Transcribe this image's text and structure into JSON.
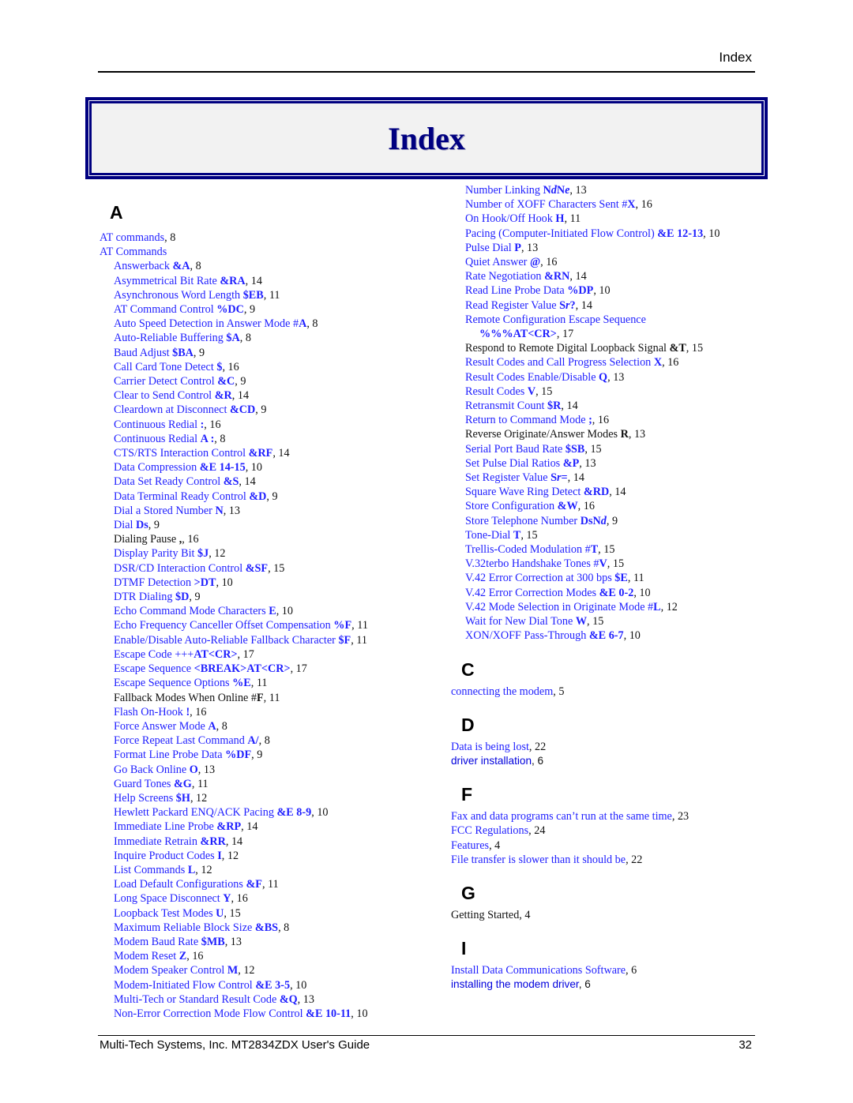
{
  "header": {
    "running_title": "Index"
  },
  "title": "Index",
  "footer": {
    "left": "Multi-Tech Systems, Inc. MT2834ZDX User's Guide",
    "page_number": "32"
  },
  "colors": {
    "link": "#1f1fff",
    "title": "#000080",
    "text": "#111111"
  },
  "left_column": {
    "sections": [
      {
        "letter": "A",
        "entries": [
          {
            "text": "AT commands",
            "code": "",
            "page": "8",
            "level": 0,
            "link": true
          },
          {
            "text": "AT Commands",
            "code": "",
            "page": "",
            "level": 0,
            "link": true
          },
          {
            "text": "Answerback ",
            "code": "&A",
            "page": "8",
            "level": 1,
            "link": true
          },
          {
            "text": "Asymmetrical Bit Rate ",
            "code": "&RA",
            "page": "14",
            "level": 1,
            "link": true
          },
          {
            "text": "Asynchronous Word Length ",
            "code": "$EB",
            "page": "11",
            "level": 1,
            "link": true
          },
          {
            "text": "AT Command Control ",
            "code": "%DC",
            "page": "9",
            "level": 1,
            "link": true
          },
          {
            "text": "Auto Speed Detection in Answer Mode #",
            "code": "A",
            "page": "8",
            "level": 1,
            "link": true
          },
          {
            "text": "Auto-Reliable Buffering ",
            "code": "$A",
            "page": "8",
            "level": 1,
            "link": true
          },
          {
            "text": "Baud Adjust ",
            "code": "$BA",
            "page": "9",
            "level": 1,
            "link": true
          },
          {
            "text": "Call Card Tone Detect ",
            "code": "$",
            "page": "16",
            "level": 1,
            "link": true
          },
          {
            "text": "Carrier Detect Control ",
            "code": "&C",
            "page": "9",
            "level": 1,
            "link": true
          },
          {
            "text": "Clear to Send Control ",
            "code": "&R",
            "page": "14",
            "level": 1,
            "link": true
          },
          {
            "text": "Cleardown at Disconnect ",
            "code": "&CD",
            "page": "9",
            "level": 1,
            "link": true
          },
          {
            "text": "Continuous Redial ",
            "code": ":",
            "page": "16",
            "level": 1,
            "link": true
          },
          {
            "text": "Continuous Redial ",
            "code": "A :",
            "page": "8",
            "level": 1,
            "link": true
          },
          {
            "text": "CTS/RTS Interaction Control ",
            "code": "&RF",
            "page": "14",
            "level": 1,
            "link": true
          },
          {
            "text": "Data Compression ",
            "code": "&E 14-15",
            "page": "10",
            "level": 1,
            "link": true
          },
          {
            "text": "Data Set Ready Control ",
            "code": "&S",
            "page": "14",
            "level": 1,
            "link": true
          },
          {
            "text": "Data Terminal Ready Control ",
            "code": "&D",
            "page": "9",
            "level": 1,
            "link": true
          },
          {
            "text": "Dial a Stored Number ",
            "code": "N",
            "page": "13",
            "level": 1,
            "link": true
          },
          {
            "text": "Dial ",
            "code": "Ds",
            "page": "9",
            "level": 1,
            "link": true
          },
          {
            "text": "Dialing Pause ",
            "code": ",",
            "page": "16",
            "level": 1,
            "link": false
          },
          {
            "text": "Display Parity Bit ",
            "code": "$J",
            "page": "12",
            "level": 1,
            "link": true
          },
          {
            "text": "DSR/CD Interaction Control ",
            "code": "&SF",
            "page": "15",
            "level": 1,
            "link": true
          },
          {
            "text": "DTMF Detection ",
            "code": ">DT",
            "page": "10",
            "level": 1,
            "link": true
          },
          {
            "text": "DTR Dialing ",
            "code": "$D",
            "page": "9",
            "level": 1,
            "link": true
          },
          {
            "text": "Echo Command Mode Characters ",
            "code": "E",
            "page": "10",
            "level": 1,
            "link": true
          },
          {
            "text": "Echo Frequency Canceller Offset Compensation ",
            "code": "%F",
            "page": "11",
            "level": 1,
            "link": true
          },
          {
            "text": "Enable/Disable Auto-Reliable Fallback Character ",
            "code": "$F",
            "page": "11",
            "level": 1,
            "link": true
          },
          {
            "text": "Escape Code +++",
            "code": "AT<CR>",
            "page": "17",
            "level": 1,
            "link": true
          },
          {
            "text": "Escape Sequence ",
            "code": "<BREAK>AT<CR>",
            "page": "17",
            "level": 1,
            "link": true
          },
          {
            "text": "Escape Sequence Options ",
            "code": "%E",
            "page": "11",
            "level": 1,
            "link": true
          },
          {
            "text": "Fallback Modes When Online #",
            "code": "F",
            "page": "11",
            "level": 1,
            "link": false
          },
          {
            "text": "Flash On-Hook ",
            "code": "!",
            "page": "16",
            "level": 1,
            "link": true
          },
          {
            "text": "Force Answer Mode ",
            "code": "A",
            "page": "8",
            "level": 1,
            "link": true
          },
          {
            "text": "Force Repeat Last Command ",
            "code": "A/",
            "page": "8",
            "level": 1,
            "link": true
          },
          {
            "text": "Format Line Probe Data ",
            "code": "%DF",
            "page": "9",
            "level": 1,
            "link": true
          },
          {
            "text": "Go Back Online ",
            "code": "O",
            "page": "13",
            "level": 1,
            "link": true
          },
          {
            "text": "Guard Tones ",
            "code": "&G",
            "page": "11",
            "level": 1,
            "link": true
          },
          {
            "text": "Help Screens ",
            "code": "$H",
            "page": "12",
            "level": 1,
            "link": true
          },
          {
            "text": "Hewlett Packard ENQ/ACK Pacing ",
            "code": "&E 8-9",
            "page": "10",
            "level": 1,
            "link": true
          },
          {
            "text": "Immediate Line Probe ",
            "code": "&RP",
            "page": "14",
            "level": 1,
            "link": true
          },
          {
            "text": "Immediate Retrain ",
            "code": "&RR",
            "page": "14",
            "level": 1,
            "link": true
          },
          {
            "text": "Inquire Product Codes ",
            "code": "I",
            "page": "12",
            "level": 1,
            "link": true
          },
          {
            "text": "List Commands ",
            "code": "L",
            "page": "12",
            "level": 1,
            "link": true
          },
          {
            "text": "Load Default Configurations ",
            "code": "&F",
            "page": "11",
            "level": 1,
            "link": true
          },
          {
            "text": "Long Space Disconnect ",
            "code": "Y",
            "page": "16",
            "level": 1,
            "link": true
          },
          {
            "text": "Loopback Test Modes ",
            "code": "U",
            "page": "15",
            "level": 1,
            "link": true
          },
          {
            "text": "Maximum Reliable Block Size ",
            "code": "&BS",
            "page": "8",
            "level": 1,
            "link": true
          },
          {
            "text": "Modem Baud Rate ",
            "code": "$MB",
            "page": "13",
            "level": 1,
            "link": true
          },
          {
            "text": "Modem Reset ",
            "code": "Z",
            "page": "16",
            "level": 1,
            "link": true
          },
          {
            "text": "Modem Speaker Control ",
            "code": "M",
            "page": "12",
            "level": 1,
            "link": true
          },
          {
            "text": "Modem-Initiated Flow Control ",
            "code": "&E 3-5",
            "page": "10",
            "level": 1,
            "link": true
          },
          {
            "text": "Multi-Tech or Standard Result Code ",
            "code": "&Q",
            "page": "13",
            "level": 1,
            "link": true
          },
          {
            "text": "Non-Error Correction Mode Flow Control ",
            "code": "&E 10-11",
            "page": "10",
            "level": 1,
            "link": true
          }
        ]
      }
    ]
  },
  "right_column": {
    "continued_entries": [
      {
        "text": "Number Linking ",
        "code": "NdNe",
        "page": "13",
        "level": 1,
        "link": true
      },
      {
        "text": "Number of XOFF Characters Sent #",
        "code": "X",
        "page": "16",
        "level": 1,
        "link": true
      },
      {
        "text": "On Hook/Off Hook ",
        "code": "H",
        "page": "11",
        "level": 1,
        "link": true
      },
      {
        "text": "Pacing (Computer-Initiated Flow Control) ",
        "code": "&E 12-13",
        "page": "10",
        "level": 1,
        "link": true
      },
      {
        "text": "Pulse Dial ",
        "code": "P",
        "page": "13",
        "level": 1,
        "link": true
      },
      {
        "text": "Quiet Answer ",
        "code": "@",
        "page": "16",
        "level": 1,
        "link": true
      },
      {
        "text": "Rate Negotiation ",
        "code": "&RN",
        "page": "14",
        "level": 1,
        "link": true
      },
      {
        "text": "Read Line Probe Data ",
        "code": "%DP",
        "page": "10",
        "level": 1,
        "link": true
      },
      {
        "text": "Read Register Value ",
        "code": "Sr?",
        "page": "14",
        "level": 1,
        "link": true
      },
      {
        "text": "Remote Configuration Escape Sequence",
        "code": "",
        "page": "",
        "level": 1,
        "link": true
      },
      {
        "text": "",
        "code": "%%%AT<CR>",
        "page": "17",
        "level": 2,
        "link": true
      },
      {
        "text": "Respond to Remote Digital Loopback Signal ",
        "code": "&T",
        "page": "15",
        "level": 1,
        "link": false
      },
      {
        "text": "Result Codes and Call Progress Selection ",
        "code": "X",
        "page": "16",
        "level": 1,
        "link": true
      },
      {
        "text": "Result Codes Enable/Disable ",
        "code": "Q",
        "page": "13",
        "level": 1,
        "link": true
      },
      {
        "text": "Result Codes ",
        "code": "V",
        "page": "15",
        "level": 1,
        "link": true
      },
      {
        "text": "Retransmit Count ",
        "code": "$R",
        "page": "14",
        "level": 1,
        "link": true
      },
      {
        "text": "Return to Command Mode ",
        "code": ";",
        "page": "16",
        "level": 1,
        "link": true
      },
      {
        "text": "Reverse Originate/Answer Modes ",
        "code": "R",
        "page": "13",
        "level": 1,
        "link": false
      },
      {
        "text": "Serial Port Baud Rate ",
        "code": "$SB",
        "page": "15",
        "level": 1,
        "link": true
      },
      {
        "text": "Set Pulse Dial Ratios ",
        "code": "&P",
        "page": "13",
        "level": 1,
        "link": true
      },
      {
        "text": "Set Register Value ",
        "code": "Sr=",
        "page": "14",
        "level": 1,
        "link": true
      },
      {
        "text": "Square Wave Ring Detect ",
        "code": "&RD",
        "page": "14",
        "level": 1,
        "link": true
      },
      {
        "text": "Store Configuration ",
        "code": "&W",
        "page": "16",
        "level": 1,
        "link": true
      },
      {
        "text": "Store Telephone Number ",
        "code": "DsNd",
        "page": "9",
        "level": 1,
        "link": true
      },
      {
        "text": "Tone-Dial ",
        "code": "T",
        "page": "15",
        "level": 1,
        "link": true
      },
      {
        "text": "Trellis-Coded Modulation #",
        "code": "T",
        "page": "15",
        "level": 1,
        "link": true
      },
      {
        "text": "V.32terbo Handshake Tones #",
        "code": "V",
        "page": "15",
        "level": 1,
        "link": true
      },
      {
        "text": "V.42 Error Correction at 300 bps ",
        "code": "$E",
        "page": "11",
        "level": 1,
        "link": true
      },
      {
        "text": "V.42 Error Correction Modes ",
        "code": "&E 0-2",
        "page": "10",
        "level": 1,
        "link": true
      },
      {
        "text": "V.42 Mode Selection in Originate Mode #",
        "code": "L",
        "page": "12",
        "level": 1,
        "link": true
      },
      {
        "text": "Wait for New Dial Tone ",
        "code": "W",
        "page": "15",
        "level": 1,
        "link": true
      },
      {
        "text": "XON/XOFF Pass-Through ",
        "code": "&E 6-7",
        "page": "10",
        "level": 1,
        "link": true
      }
    ],
    "sections": [
      {
        "letter": "C",
        "entries": [
          {
            "text": "connecting the modem",
            "code": "",
            "page": "5",
            "level": 0,
            "link": true
          }
        ]
      },
      {
        "letter": "D",
        "entries": [
          {
            "text": "Data is being lost",
            "code": "",
            "page": "22",
            "level": 0,
            "link": true
          },
          {
            "text": "driver installation",
            "code": "",
            "page": "6",
            "level": 0,
            "link": true,
            "sans": true
          }
        ]
      },
      {
        "letter": "F",
        "entries": [
          {
            "text": "Fax and data programs can’t run at the same time",
            "code": "",
            "page": "23",
            "level": 0,
            "link": true
          },
          {
            "text": "FCC Regulations",
            "code": "",
            "page": "24",
            "level": 0,
            "link": true
          },
          {
            "text": "Features",
            "code": "",
            "page": "4",
            "level": 0,
            "link": true
          },
          {
            "text": "File transfer is slower than it should be",
            "code": "",
            "page": "22",
            "level": 0,
            "link": true
          }
        ]
      },
      {
        "letter": "G",
        "entries": [
          {
            "text": "Getting Started",
            "code": "",
            "page": "4",
            "level": 0,
            "link": false
          }
        ]
      },
      {
        "letter": "I",
        "entries": [
          {
            "text": "Install Data Communications Software",
            "code": "",
            "page": "6",
            "level": 0,
            "link": true
          },
          {
            "text": "installing the modem driver",
            "code": "",
            "page": "6",
            "level": 0,
            "link": true,
            "sans": true
          }
        ]
      }
    ]
  }
}
